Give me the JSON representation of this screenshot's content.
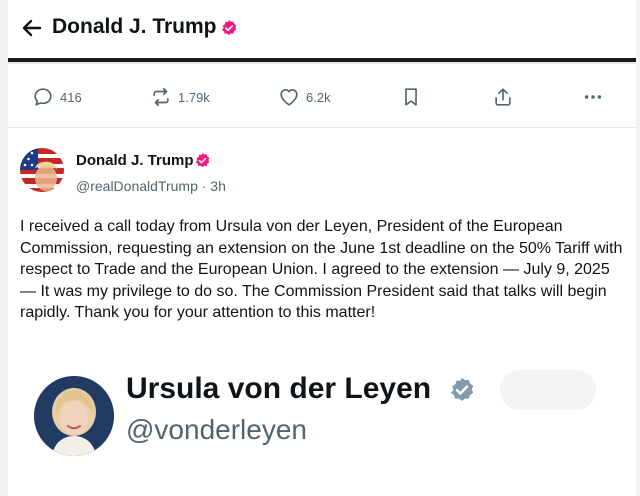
{
  "header": {
    "title": "Donald J. Trump"
  },
  "actions": {
    "replies": "416",
    "reposts": "1.79k",
    "likes": "6.2k"
  },
  "tweet": {
    "author_name": "Donald J. Trump",
    "handle_time": "@realDonaldTrump · 3h",
    "text": "I received a call today from Ursula von der Leyen, President of the European Commission, requesting an extension on the June 1st deadline on the 50% Tariff with respect to Trade and the European Union. I agreed to the extension — July 9, 2025 — It was my privilege to do so. The Commission President said that talks will begin rapidly. Thank you for your attention to this matter!"
  },
  "embed": {
    "name": "Ursula von der Leyen",
    "handle": "@vonderleyen"
  },
  "colors": {
    "verified_header": "#f91880",
    "verified_embed": "#829aab",
    "text_primary": "#0f1419",
    "text_secondary": "#536471"
  },
  "icons": [
    "back-arrow-icon",
    "verified-badge-icon",
    "reply-icon",
    "repost-icon",
    "like-icon",
    "bookmark-icon",
    "share-icon",
    "more-icon"
  ]
}
